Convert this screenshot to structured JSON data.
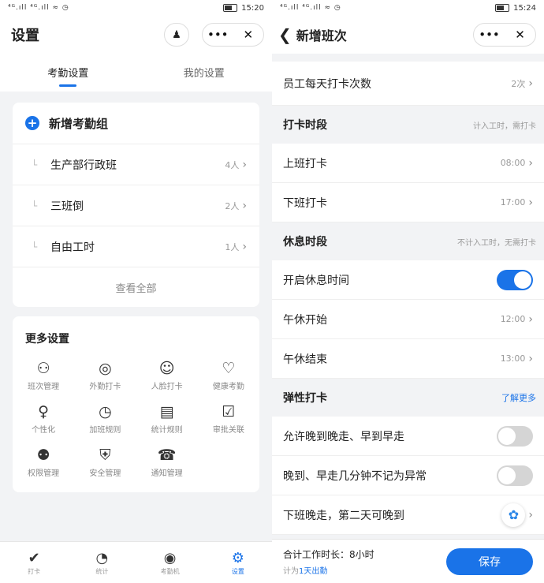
{
  "left": {
    "status": {
      "signal": "⁴ᴳ.ıll ⁴ᴳ.ıll ≈ ◷",
      "time": "15:20"
    },
    "title": "设置",
    "tabs": [
      "考勤设置",
      "我的设置"
    ],
    "add_group": "新增考勤组",
    "groups": [
      {
        "name": "生产部行政班",
        "count": "4人"
      },
      {
        "name": "三班倒",
        "count": "2人"
      },
      {
        "name": "自由工时",
        "count": "1人"
      }
    ],
    "view_all": "查看全部",
    "more_title": "更多设置",
    "more_items": [
      {
        "label": "班次管理",
        "icon": "⚇"
      },
      {
        "label": "外勤打卡",
        "icon": "◎"
      },
      {
        "label": "人脸打卡",
        "icon": "☺"
      },
      {
        "label": "健康考勤",
        "icon": "♡"
      },
      {
        "label": "个性化",
        "icon": "♀"
      },
      {
        "label": "加班规则",
        "icon": "◷"
      },
      {
        "label": "统计规则",
        "icon": "▤"
      },
      {
        "label": "审批关联",
        "icon": "☑"
      },
      {
        "label": "权限管理",
        "icon": "⚉"
      },
      {
        "label": "安全管理",
        "icon": "⛨"
      },
      {
        "label": "通知管理",
        "icon": "☎"
      }
    ],
    "nav": [
      {
        "label": "打卡",
        "icon": "✔"
      },
      {
        "label": "统计",
        "icon": "◔"
      },
      {
        "label": "考勤机",
        "icon": "◉"
      },
      {
        "label": "设置",
        "icon": "⚙"
      }
    ]
  },
  "right": {
    "status": {
      "signal": "⁴ᴳ.ıll ⁴ᴳ.ıll ≈ ◷",
      "time": "15:24"
    },
    "title": "新增班次",
    "daily_punch": {
      "label": "员工每天打卡次数",
      "value": "2次"
    },
    "punch_section": {
      "title": "打卡时段",
      "note": "计入工时，需打卡"
    },
    "on_duty": {
      "label": "上班打卡",
      "value": "08:00"
    },
    "off_duty": {
      "label": "下班打卡",
      "value": "17:00"
    },
    "rest_section": {
      "title": "休息时段",
      "note": "不计入工时，无需打卡"
    },
    "rest_enable": {
      "label": "开启休息时间",
      "on": true
    },
    "lunch_start": {
      "label": "午休开始",
      "value": "12:00"
    },
    "lunch_end": {
      "label": "午休结束",
      "value": "13:00"
    },
    "flex_section": {
      "title": "弹性打卡",
      "link": "了解更多"
    },
    "flex1": {
      "label": "允许晚到晚走、早到早走",
      "on": false
    },
    "flex2": {
      "label": "晚到、早走几分钟不记为异常",
      "on": false
    },
    "flex3": {
      "label": "下班晚走，第二天可晚到"
    },
    "footer": {
      "total": "合计工作时长：8小时",
      "prefix": "计为",
      "days": "1天出勤",
      "save": "保存"
    }
  },
  "colors": {
    "accent": "#1a73e8",
    "background": "#f2f3f5"
  }
}
